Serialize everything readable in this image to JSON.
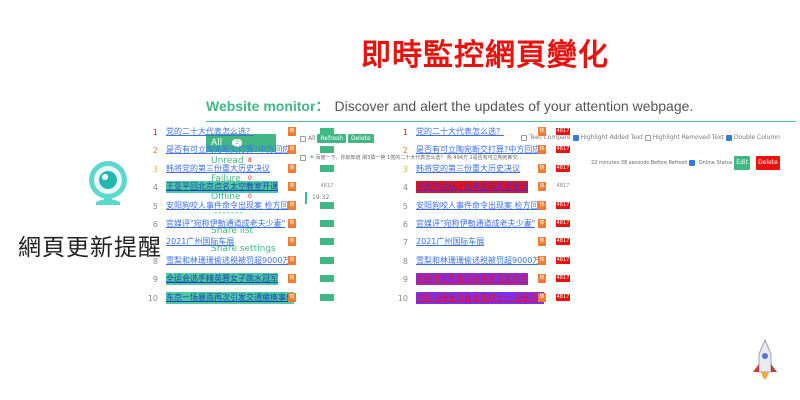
{
  "headline": "即時監控網頁變化",
  "brand": {
    "name": "網頁更新提醒"
  },
  "app": {
    "title": "Website monitor：",
    "subtitle": "Discover and alert the updates of your attention webpage."
  },
  "sidebar": {
    "items": [
      {
        "label": "All",
        "count": "1",
        "active": true
      },
      {
        "label": "Unread",
        "count": "8"
      },
      {
        "label": "Failure",
        "count": "0"
      },
      {
        "label": "Offline",
        "count": "0"
      }
    ],
    "separator": "-------",
    "extra": [
      {
        "label": "Share list"
      },
      {
        "label": "Share settings"
      }
    ]
  },
  "toolbar": {
    "all_label": "All",
    "refresh_label": "Refresh",
    "delete_label": "Delete",
    "options": [
      {
        "label": "Text Compare",
        "checked": false
      },
      {
        "label": "Highlight Added Text",
        "checked": true
      },
      {
        "label": "Highlight Removed Text",
        "checked": false
      },
      {
        "label": "Double Column",
        "checked": true
      }
    ]
  },
  "task": {
    "title": "百度一下，你就知道",
    "text": "閏3換一换 1党的二十大代表怎么选？ 热 494万 2是否有可立陶宛断交...",
    "status": "22 minutes 38 seconds Before Refresh",
    "online_label": "Online Status",
    "edit_label": "Edit",
    "delete_label": "Delete"
  },
  "timeline": {
    "time": "19:32"
  },
  "left_column": [
    {
      "num": "1",
      "text": "党的二十大代表怎么选？",
      "icon": "热",
      "style": "plain"
    },
    {
      "num": "2",
      "text": "是否有可立陶宛断交打算?中方回应",
      "icon": "热",
      "style": "plain"
    },
    {
      "num": "3",
      "text": "韩将党的第三份重大历史决议",
      "icon": "热",
      "style": "plain"
    },
    {
      "num": "4",
      "text": "王亚平回北京点名太空教室开课",
      "icon": "热",
      "style": "hl-green",
      "value": "4817"
    },
    {
      "num": "5",
      "text": "安阳狗咬人事件命令出现案 检方回应",
      "icon": "热",
      "style": "plain"
    },
    {
      "num": "6",
      "text": "官媒评\"宛称伊勒通道成老夫少妻\"",
      "icon": "热",
      "style": "plain"
    },
    {
      "num": "7",
      "text": "2021广州国际车展",
      "icon": "热",
      "style": "plain"
    },
    {
      "num": "8",
      "text": "雪梨和林珊珊偷逃税被罚超9000万",
      "icon": "热",
      "style": "plain"
    },
    {
      "num": "9",
      "text": "全运会选手精英赛女子跳水冠军",
      "icon": "热",
      "style": "hl-green"
    },
    {
      "num": "10",
      "text": "东京一场暴雨再次引发交通瘫痪事件",
      "icon": "热",
      "style": "hl-green"
    }
  ],
  "right_column": [
    {
      "num": "1",
      "text": "党的二十大代表怎么选？",
      "icon": "热",
      "value": "4817",
      "style": "plain"
    },
    {
      "num": "2",
      "text": "是否有可立陶宛断交打算?中方回应",
      "icon": "热",
      "value": "4817",
      "style": "plain"
    },
    {
      "num": "3",
      "text": "韩将党的第三份重大历史决议",
      "icon": "热",
      "value": "4817",
      "style": "plain"
    },
    {
      "num": "4",
      "text": "中国空间站计划年底前完成建造",
      "icon": "热",
      "value": "4817",
      "style": "hl-red"
    },
    {
      "num": "5",
      "text": "安阳狗咬人事件命令出现案 检方回应",
      "icon": "热",
      "value": "4817",
      "style": "plain"
    },
    {
      "num": "6",
      "text": "官媒评\"宛称伊勒通道成老夫少妻\"",
      "icon": "热",
      "value": "4817",
      "style": "plain"
    },
    {
      "num": "7",
      "text": "2021广州国际车展",
      "icon": "热",
      "value": "4817",
      "style": "plain"
    },
    {
      "num": "8",
      "text": "雪梨和林珊珊偷逃税被罚超9000万",
      "icon": "热",
      "value": "4817",
      "style": "plain"
    },
    {
      "num": "9",
      "text": "美国研究称新冠病毒源自实验室",
      "icon": "热",
      "value": "4817",
      "style": "hl-purple"
    },
    {
      "num": "10",
      "text": "中国消费者协会发布双十一消费提示",
      "icon": "热",
      "value": "4817",
      "style": "hl-purple"
    }
  ],
  "colors": {
    "accent": "#41b883",
    "headline": "#e8130f",
    "highlight_blue": "#3a6ff0",
    "highlight_green": "#4ec9a0",
    "highlight_red": "#e8130f",
    "highlight_purple": "#7b2ff7"
  }
}
